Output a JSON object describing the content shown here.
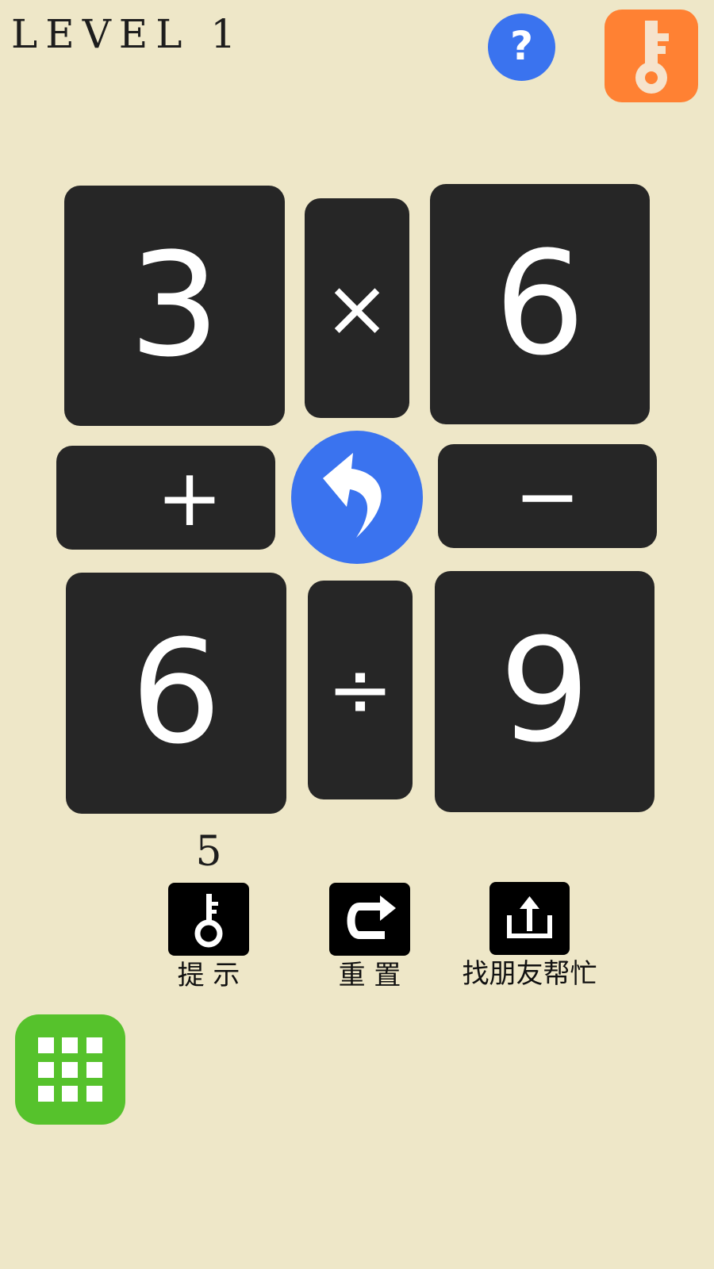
{
  "header": {
    "level_title": "LEVEL 1",
    "help_icon": "question-icon",
    "key_icon": "key-icon",
    "help_color": "#3a73ef",
    "key_color": "#ff8133"
  },
  "board": {
    "top_left": "3",
    "top_op": "×",
    "top_right": "6",
    "mid_left_op": "+",
    "mid_right_op": "−",
    "bottom_left": "6",
    "bottom_op": "÷",
    "bottom_right": "9",
    "undo_icon": "undo-arrow-icon",
    "tile_color": "#262626"
  },
  "toolbar": {
    "hint_count": "5",
    "hint_label": "提 示",
    "reset_label": "重  置",
    "share_label": "找朋友帮忙",
    "hint_icon": "key-icon",
    "reset_icon": "redo-arrow-icon",
    "share_icon": "share-icon"
  },
  "menu": {
    "icon": "grid-icon",
    "color": "#56c22c"
  }
}
